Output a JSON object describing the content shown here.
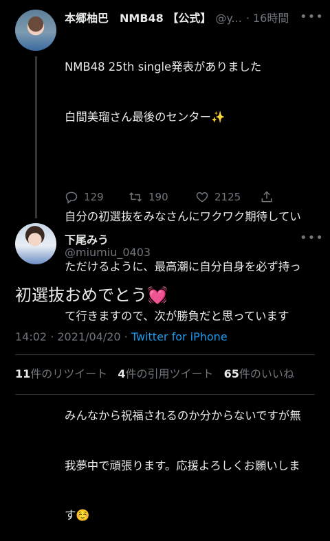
{
  "tweet1": {
    "name": "本郷柚巴　NMB48 【公式】",
    "handle": "@y...",
    "time": "· 16時間",
    "more": "•••",
    "lines": [
      "NMB48 25th single発表がありました",
      "白間美瑠さん最後のセンター✨",
      "",
      "自分の初選抜をみなさんにワクワク期待してい",
      "ただけるように、最高潮に自分自身を必ず持っ",
      "て行きますので、次が勝負だと思っています",
      "",
      "みんなから祝福されるのか分からないですが無",
      "我夢中で頑張ります。応援よろしくお願いしま",
      "す☺️"
    ],
    "replies": "129",
    "retweets": "190",
    "likes": "2125",
    "icons": [
      "reply-icon",
      "retweet-icon",
      "like-icon",
      "share-icon"
    ]
  },
  "tweet2": {
    "name": "下尾みう",
    "handle": "@miumiu_0403",
    "more": "•••",
    "text": "初選抜おめでとう💓",
    "time": "14:02",
    "separator": " · ",
    "date": "2021/04/20",
    "source": "Twitter for iPhone",
    "retweet_count": "11",
    "retweet_label": "件のリツイート",
    "quote_count": "4",
    "quote_label": "件の引用ツイート",
    "like_count": "65",
    "like_label": "件のいいね"
  },
  "colors": {
    "background": "#000000",
    "text": "#e7e9ea",
    "muted": "#71767b",
    "link": "#1d9bf0"
  }
}
